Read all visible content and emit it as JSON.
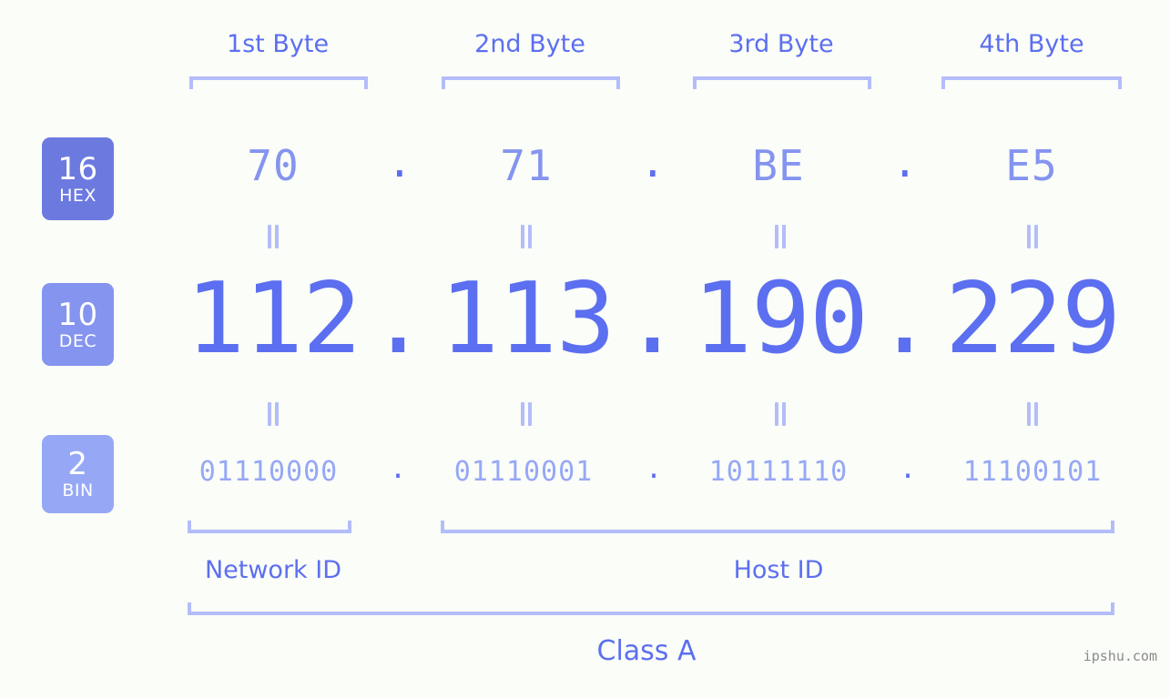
{
  "byte_headers": [
    {
      "label": "1st Byte"
    },
    {
      "label": "2nd Byte"
    },
    {
      "label": "3rd Byte"
    },
    {
      "label": "4th Byte"
    }
  ],
  "systems": [
    {
      "base": "16",
      "name": "HEX",
      "color": "#6c7ae0"
    },
    {
      "base": "10",
      "name": "DEC",
      "color": "#8494ef"
    },
    {
      "base": "2",
      "name": "BIN",
      "color": "#96a8f5"
    }
  ],
  "hex": {
    "octets": [
      "70",
      "71",
      "BE",
      "E5"
    ],
    "separator": "."
  },
  "dec": {
    "octets": [
      "112",
      "113",
      "190",
      "229"
    ],
    "separator": "."
  },
  "bin": {
    "octets": [
      "01110000",
      "01110001",
      "10111110",
      "11100101"
    ],
    "separator": "."
  },
  "equals_marker": "=",
  "footer": {
    "network_id": "Network ID",
    "host_id": "Host ID",
    "class": "Class A"
  },
  "watermark": "ipshu.com",
  "colors": {
    "background": "#fbfdf9",
    "text_blue": "#5c6ff0",
    "bracket": "#b3bdfa",
    "hex_value": "#8494ef",
    "bin_value": "#96a8f5"
  }
}
